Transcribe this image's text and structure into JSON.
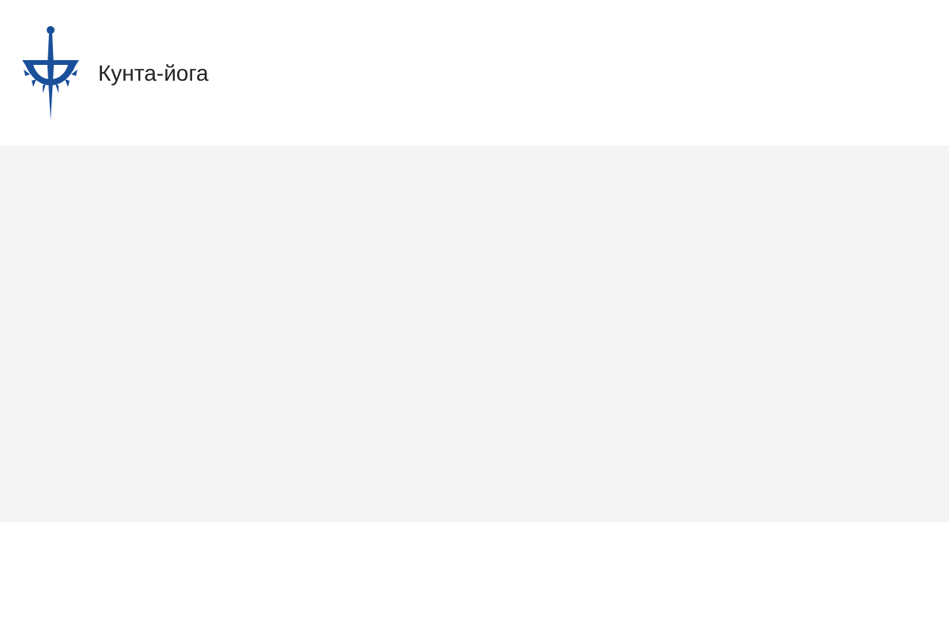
{
  "header": {
    "site_name": "Кунта-йога"
  }
}
